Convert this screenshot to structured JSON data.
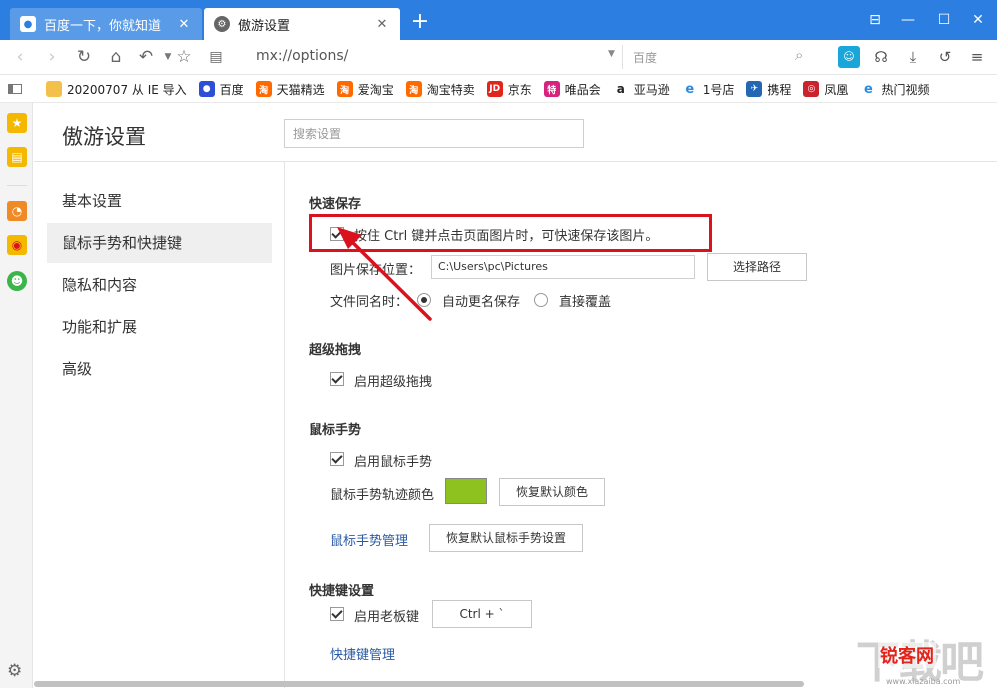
{
  "tabs": [
    {
      "label": "百度一下，你就知道",
      "icon": "baidu-paw-icon",
      "active": false
    },
    {
      "label": "傲游设置",
      "icon": "settings-gear-icon",
      "active": true
    }
  ],
  "new_tab_label": "+",
  "window_controls": {
    "icon_panel": "⊟",
    "minimize": "—",
    "maximize": "☐",
    "close": "✕"
  },
  "address_bar": {
    "url": "mx://options/",
    "search_placeholder": "百度"
  },
  "bookmarks": [
    {
      "label": "20200707 从 IE 导入",
      "icon": "folder-icon",
      "color": "#f3c14b"
    },
    {
      "label": "百度",
      "icon": "baidu-paw-icon",
      "color": "#2c4fd6"
    },
    {
      "label": "天猫精选",
      "icon": "taobao-icon",
      "color": "#ff6a00"
    },
    {
      "label": "爱淘宝",
      "icon": "taobao-icon",
      "color": "#ff6a00"
    },
    {
      "label": "淘宝特卖",
      "icon": "taobao-icon",
      "color": "#ff6a00"
    },
    {
      "label": "京东",
      "icon": "jd-icon",
      "color": "#e1251b"
    },
    {
      "label": "唯品会",
      "icon": "vip-icon",
      "color": "#d6237d"
    },
    {
      "label": "亚马逊",
      "icon": "amazon-icon",
      "color": "#222222"
    },
    {
      "label": "1号店",
      "icon": "ie-icon",
      "color": "#2c8be0"
    },
    {
      "label": "携程",
      "icon": "ctrip-icon",
      "color": "#2467b3"
    },
    {
      "label": "凤凰",
      "icon": "ifeng-icon",
      "color": "#c9232d"
    },
    {
      "label": "热门视频",
      "icon": "ie-icon",
      "color": "#2c8be0"
    }
  ],
  "page": {
    "title": "傲游设置",
    "search_placeholder": "搜索设置"
  },
  "nav": [
    {
      "label": "基本设置",
      "active": false
    },
    {
      "label": "鼠标手势和快捷键",
      "active": true
    },
    {
      "label": "隐私和内容",
      "active": false
    },
    {
      "label": "功能和扩展",
      "active": false
    },
    {
      "label": "高级",
      "active": false
    }
  ],
  "quick_save": {
    "title": "快速保存",
    "ctrl_click_label": "按住 Ctrl 键并点击页面图片时，可快速保存该图片。",
    "ctrl_click_checked": true,
    "location_label": "图片保存位置：",
    "location_value": "C:\\Users\\pc\\Pictures",
    "choose_path_label": "选择路径",
    "same_name_label": "文件同名时：",
    "radio_rename_label": "自动更名保存",
    "radio_overwrite_label": "直接覆盖",
    "selected": "rename"
  },
  "super_drag": {
    "title": "超级拖拽",
    "enable_label": "启用超级拖拽",
    "checked": true
  },
  "mouse_gesture": {
    "title": "鼠标手势",
    "enable_label": "启用鼠标手势",
    "checked": true,
    "trail_color_label": "鼠标手势轨迹颜色",
    "trail_color": "#8ec21f",
    "restore_color_label": "恢复默认颜色",
    "manage_link": "鼠标手势管理",
    "restore_settings_label": "恢复默认鼠标手势设置"
  },
  "shortcuts": {
    "title": "快捷键设置",
    "boss_key_label": "启用老板键",
    "checked": true,
    "boss_key_value": "Ctrl + `",
    "manage_link": "快捷键管理"
  },
  "watermark": {
    "big": "下载吧",
    "badge": "锐客网",
    "url": "www.xiazaiba.com"
  },
  "colors": {
    "titlebar": "#2c7fe0",
    "highlight": "#d9121e",
    "link": "#2a5aa5"
  }
}
